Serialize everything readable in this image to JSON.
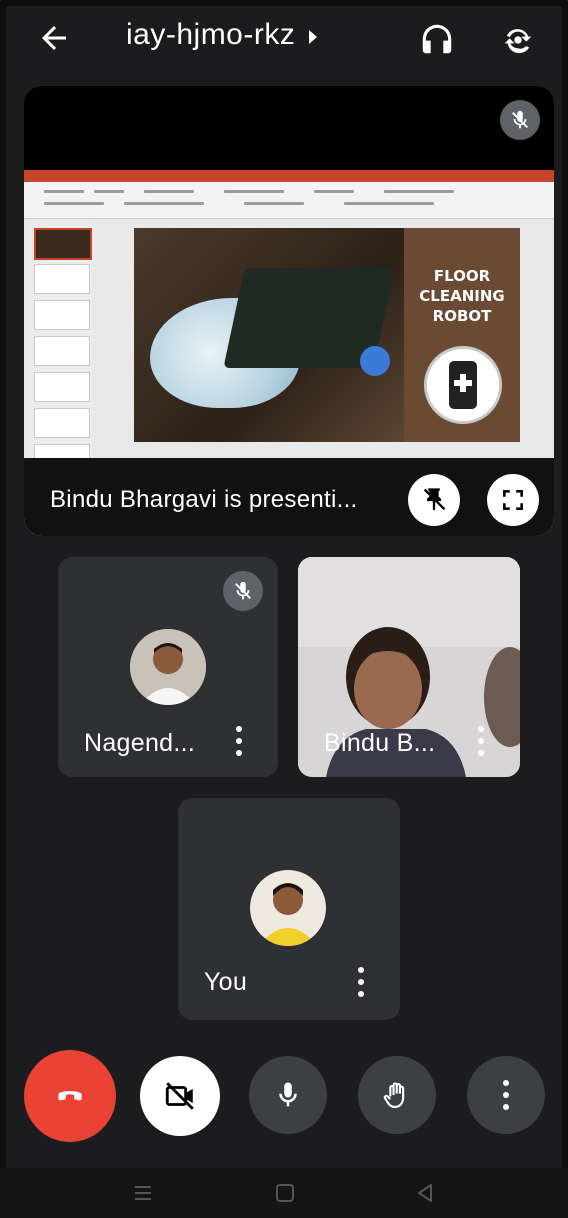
{
  "header": {
    "meeting_code": "iay-hjmo-rkz",
    "back_icon": "arrow-left-icon",
    "audio_icon": "headphones-icon",
    "switch_camera_icon": "switch-camera-icon"
  },
  "presentation": {
    "slide_text": [
      "FLOOR",
      "CLEANING",
      "ROBOT"
    ],
    "status": "Bindu Bhargavi is presenti...",
    "muted": true
  },
  "participants": [
    {
      "name": "Nagend...",
      "muted": true
    },
    {
      "name": "Bindu B...",
      "muted": false
    },
    {
      "name": "You",
      "muted": false
    }
  ],
  "controls": [
    {
      "name": "end-call",
      "icon": "phone-hangup-icon",
      "color": "#ea4335"
    },
    {
      "name": "camera-off",
      "icon": "video-off-icon",
      "color": "#ffffff"
    },
    {
      "name": "microphone",
      "icon": "mic-icon",
      "color": "#3c4043"
    },
    {
      "name": "raise-hand",
      "icon": "hand-icon",
      "color": "#3c4043"
    },
    {
      "name": "more-options",
      "icon": "more-vert-icon",
      "color": "#3c4043"
    }
  ],
  "colors": {
    "background": "#1c1c1e",
    "tile": "#2e3033",
    "accent_red": "#ea4335"
  }
}
